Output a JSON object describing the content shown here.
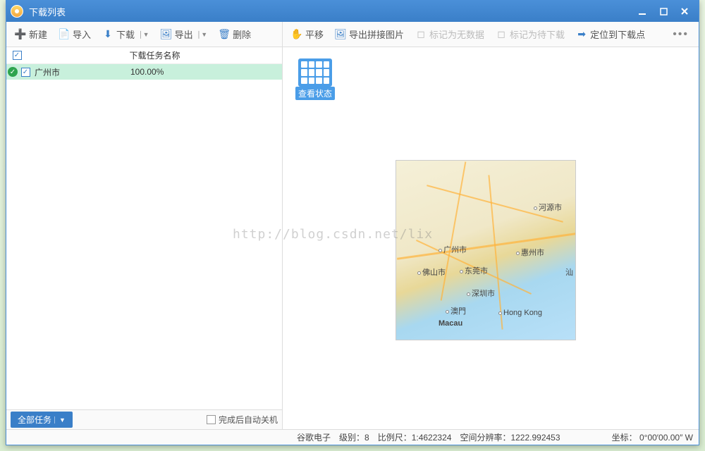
{
  "titlebar": {
    "title": "下载列表"
  },
  "toolbar_left": {
    "new": "新建",
    "import": "导入",
    "download": "下载",
    "export": "导出",
    "delete": "删除"
  },
  "toolbar_right": {
    "pan": "平移",
    "export_tile": "导出拼接图片",
    "mark_nodata": "标记为无数据",
    "mark_download": "标记为待下载",
    "locate": "定位到下载点"
  },
  "listhead": {
    "name": "下载任务名称"
  },
  "task": {
    "name": "广州市",
    "progress": "100.00%"
  },
  "status_grid": {
    "label": "查看状态"
  },
  "leftfoot": {
    "all": "全部任务",
    "shutdown": "完成后自动关机"
  },
  "map_cities": {
    "guangzhou": "广州市",
    "foshan": "佛山市",
    "dongguan": "东莞市",
    "shenzhen": "深圳市",
    "macau_cn": "澳門",
    "huizhou": "惠州市",
    "heyuan": "河源市",
    "hongkong": "Hong Kong",
    "macau_en": "Macau",
    "shan": "汕"
  },
  "watermark": "http://blog.csdn.net/lix",
  "statusbar": {
    "source": "谷歌电子",
    "level": "级别：8",
    "scale": "比例尺：1:4622324",
    "resolution": "空间分辨率：1222.992453",
    "coord": "坐标：  0°00′00.00″ W"
  }
}
